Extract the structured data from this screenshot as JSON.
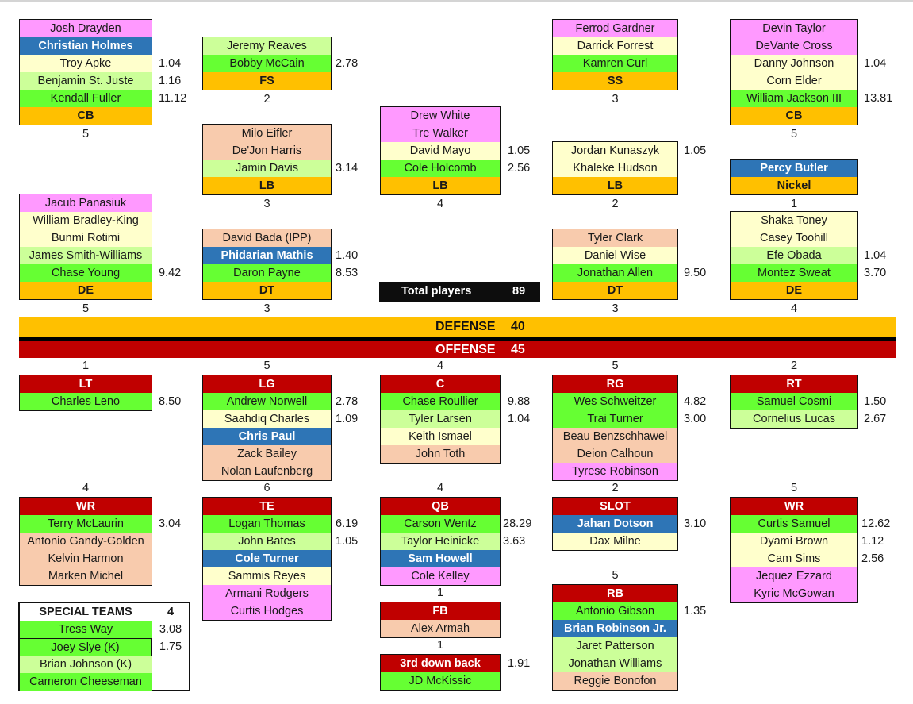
{
  "summary": {
    "total_label": "Total players",
    "total_value": "89",
    "defense_label": "DEFENSE",
    "defense_value": "40",
    "offense_label": "OFFENSE",
    "offense_value": "45"
  },
  "colors": {
    "practice_squad": "#ff99ff",
    "rookie": "#2e75b6",
    "cream": "#ffffcc",
    "light_green": "#ccff99",
    "starter_green": "#66ff33",
    "peach": "#f8cbad",
    "defense_header": "#ffc000",
    "offense_header": "#c00000"
  },
  "defense": {
    "cb_left": {
      "position": "CB",
      "count": "5",
      "players": [
        {
          "name": "Josh Drayden",
          "value": "",
          "color": "pink"
        },
        {
          "name": "Christian Holmes",
          "value": "",
          "color": "blue"
        },
        {
          "name": "Troy Apke",
          "value": "1.04",
          "color": "cream"
        },
        {
          "name": "Benjamin St. Juste",
          "value": "1.16",
          "color": "lgreen"
        },
        {
          "name": "Kendall Fuller",
          "value": "11.12",
          "color": "green"
        }
      ]
    },
    "fs": {
      "position": "FS",
      "count": "2",
      "players": [
        {
          "name": "Jeremy Reaves",
          "value": "",
          "color": "lgreen"
        },
        {
          "name": "Bobby McCain",
          "value": "2.78",
          "color": "green"
        }
      ]
    },
    "ss": {
      "position": "SS",
      "count": "3",
      "players": [
        {
          "name": "Ferrod Gardner",
          "value": "",
          "color": "pink"
        },
        {
          "name": "Darrick Forrest",
          "value": "",
          "color": "cream"
        },
        {
          "name": "Kamren Curl",
          "value": "",
          "color": "green"
        }
      ]
    },
    "cb_right": {
      "position": "CB",
      "count": "5",
      "players": [
        {
          "name": "Devin Taylor",
          "value": "",
          "color": "pink"
        },
        {
          "name": "DeVante Cross",
          "value": "",
          "color": "pink"
        },
        {
          "name": "Danny Johnson",
          "value": "1.04",
          "color": "cream"
        },
        {
          "name": "Corn Elder",
          "value": "",
          "color": "cream"
        },
        {
          "name": "William Jackson III",
          "value": "13.81",
          "color": "green"
        }
      ]
    },
    "lb_left": {
      "position": "LB",
      "count": "3",
      "players": [
        {
          "name": "Milo Eifler",
          "value": "",
          "color": "peach"
        },
        {
          "name": "De'Jon Harris",
          "value": "",
          "color": "peach"
        },
        {
          "name": "Jamin Davis",
          "value": "3.14",
          "color": "lgreen"
        }
      ]
    },
    "lb_mid": {
      "position": "LB",
      "count": "4",
      "players": [
        {
          "name": "Drew White",
          "value": "",
          "color": "pink"
        },
        {
          "name": "Tre Walker",
          "value": "",
          "color": "pink"
        },
        {
          "name": "David Mayo",
          "value": "1.05",
          "color": "cream"
        },
        {
          "name": "Cole Holcomb",
          "value": "2.56",
          "color": "green"
        }
      ]
    },
    "lb_right": {
      "position": "LB",
      "count": "2",
      "players": [
        {
          "name": "Jordan Kunaszyk",
          "value": "1.05",
          "color": "cream"
        },
        {
          "name": "Khaleke Hudson",
          "value": "",
          "color": "cream"
        }
      ]
    },
    "nickel": {
      "position": "Nickel",
      "count": "1",
      "players": [
        {
          "name": "Percy Butler",
          "value": "",
          "color": "blue"
        }
      ]
    },
    "de_left": {
      "position": "DE",
      "count": "5",
      "players": [
        {
          "name": "Jacub Panasiuk",
          "value": "",
          "color": "pink"
        },
        {
          "name": "William Bradley-King",
          "value": "",
          "color": "cream"
        },
        {
          "name": "Bunmi Rotimi",
          "value": "",
          "color": "cream"
        },
        {
          "name": "James Smith-Williams",
          "value": "",
          "color": "lgreen"
        },
        {
          "name": "Chase Young",
          "value": "9.42",
          "color": "green"
        }
      ]
    },
    "dt_left": {
      "position": "DT",
      "count": "3",
      "players": [
        {
          "name": "David Bada (IPP)",
          "value": "",
          "color": "peach"
        },
        {
          "name": "Phidarian Mathis",
          "value": "1.40",
          "color": "blue"
        },
        {
          "name": "Daron Payne",
          "value": "8.53",
          "color": "green"
        }
      ]
    },
    "dt_right": {
      "position": "DT",
      "count": "3",
      "players": [
        {
          "name": "Tyler Clark",
          "value": "",
          "color": "peach"
        },
        {
          "name": "Daniel Wise",
          "value": "",
          "color": "cream"
        },
        {
          "name": "Jonathan Allen",
          "value": "9.50",
          "color": "green"
        }
      ]
    },
    "de_right": {
      "position": "DE",
      "count": "4",
      "players": [
        {
          "name": "Shaka Toney",
          "value": "",
          "color": "cream"
        },
        {
          "name": "Casey Toohill",
          "value": "",
          "color": "cream"
        },
        {
          "name": "Efe Obada",
          "value": "1.04",
          "color": "lgreen"
        },
        {
          "name": "Montez Sweat",
          "value": "3.70",
          "color": "green"
        }
      ]
    }
  },
  "offense": {
    "lt": {
      "position": "LT",
      "count": "1",
      "players": [
        {
          "name": "Charles Leno",
          "value": "8.50",
          "color": "green"
        }
      ]
    },
    "lg": {
      "position": "LG",
      "count": "5",
      "players": [
        {
          "name": "Andrew Norwell",
          "value": "2.78",
          "color": "green"
        },
        {
          "name": "Saahdiq Charles",
          "value": "1.09",
          "color": "cream"
        },
        {
          "name": "Chris Paul",
          "value": "",
          "color": "blue"
        },
        {
          "name": "Zack Bailey",
          "value": "",
          "color": "peach"
        },
        {
          "name": "Nolan Laufenberg",
          "value": "",
          "color": "peach"
        }
      ]
    },
    "c": {
      "position": "C",
      "count": "4",
      "players": [
        {
          "name": "Chase Roullier",
          "value": "9.88",
          "color": "green"
        },
        {
          "name": "Tyler Larsen",
          "value": "1.04",
          "color": "lgreen"
        },
        {
          "name": "Keith Ismael",
          "value": "",
          "color": "cream"
        },
        {
          "name": "John Toth",
          "value": "",
          "color": "peach"
        }
      ]
    },
    "rg": {
      "position": "RG",
      "count": "5",
      "players": [
        {
          "name": "Wes Schweitzer",
          "value": "4.82",
          "color": "green"
        },
        {
          "name": "Trai Turner",
          "value": "3.00",
          "color": "green"
        },
        {
          "name": "Beau Benzschhawel",
          "value": "",
          "color": "peach"
        },
        {
          "name": "Deion Calhoun",
          "value": "",
          "color": "peach"
        },
        {
          "name": "Tyrese Robinson",
          "value": "",
          "color": "pink"
        }
      ]
    },
    "rt": {
      "position": "RT",
      "count": "2",
      "players": [
        {
          "name": "Samuel Cosmi",
          "value": "1.50",
          "color": "green"
        },
        {
          "name": "Cornelius Lucas",
          "value": "2.67",
          "color": "lgreen"
        }
      ]
    },
    "wr_left": {
      "position": "WR",
      "count": "4",
      "players": [
        {
          "name": "Terry McLaurin",
          "value": "3.04",
          "color": "green"
        },
        {
          "name": "Antonio Gandy-Golden",
          "value": "",
          "color": "peach"
        },
        {
          "name": "Kelvin Harmon",
          "value": "",
          "color": "peach"
        },
        {
          "name": "Marken Michel",
          "value": "",
          "color": "peach"
        }
      ]
    },
    "te": {
      "position": "TE",
      "count": "6",
      "players": [
        {
          "name": "Logan Thomas",
          "value": "6.19",
          "color": "green"
        },
        {
          "name": "John Bates",
          "value": "1.05",
          "color": "lgreen"
        },
        {
          "name": "Cole Turner",
          "value": "",
          "color": "blue"
        },
        {
          "name": "Sammis Reyes",
          "value": "",
          "color": "cream"
        },
        {
          "name": "Armani Rodgers",
          "value": "",
          "color": "pink"
        },
        {
          "name": "Curtis Hodges",
          "value": "",
          "color": "pink"
        }
      ]
    },
    "qb": {
      "position": "QB",
      "count": "4",
      "players": [
        {
          "name": "Carson Wentz",
          "value": "28.29",
          "color": "green"
        },
        {
          "name": "Taylor Heinicke",
          "value": "3.63",
          "color": "lgreen"
        },
        {
          "name": "Sam Howell",
          "value": "",
          "color": "blue"
        },
        {
          "name": "Cole Kelley",
          "value": "",
          "color": "pink"
        }
      ]
    },
    "slot": {
      "position": "SLOT",
      "count": "2",
      "players": [
        {
          "name": "Jahan Dotson",
          "value": "3.10",
          "color": "blue"
        },
        {
          "name": "Dax Milne",
          "value": "",
          "color": "cream"
        }
      ]
    },
    "wr_right": {
      "position": "WR",
      "count": "5",
      "players": [
        {
          "name": "Curtis Samuel",
          "value": "12.62",
          "color": "green"
        },
        {
          "name": "Dyami Brown",
          "value": "1.12",
          "color": "cream"
        },
        {
          "name": "Cam Sims",
          "value": "2.56",
          "color": "cream"
        },
        {
          "name": "Jequez Ezzard",
          "value": "",
          "color": "pink"
        },
        {
          "name": "Kyric McGowan",
          "value": "",
          "color": "pink"
        }
      ]
    },
    "fb": {
      "position": "FB",
      "count": "1",
      "players": [
        {
          "name": "Alex Armah",
          "value": "",
          "color": "peach"
        }
      ]
    },
    "third_down": {
      "position": "3rd down back",
      "count": "1",
      "header_value": "1.91",
      "players": [
        {
          "name": "JD McKissic",
          "value": "",
          "color": "green"
        }
      ]
    },
    "rb": {
      "position": "RB",
      "count": "5",
      "players": [
        {
          "name": "Antonio Gibson",
          "value": "1.35",
          "color": "green"
        },
        {
          "name": "Brian Robinson Jr.",
          "value": "",
          "color": "blue"
        },
        {
          "name": "Jaret Patterson",
          "value": "",
          "color": "lgreen"
        },
        {
          "name": "Jonathan Williams",
          "value": "",
          "color": "lgreen"
        },
        {
          "name": "Reggie Bonofon",
          "value": "",
          "color": "peach"
        }
      ]
    }
  },
  "special_teams": {
    "label": "SPECIAL TEAMS",
    "count": "4",
    "players": [
      {
        "name": "Tress Way",
        "value": "3.08",
        "color": "green"
      },
      {
        "name": "Joey Slye (K)",
        "value": "1.75",
        "color": "green"
      },
      {
        "name": "Brian Johnson (K)",
        "value": "",
        "color": "lgreen"
      },
      {
        "name": "Cameron Cheeseman",
        "value": "",
        "color": "green"
      }
    ]
  }
}
